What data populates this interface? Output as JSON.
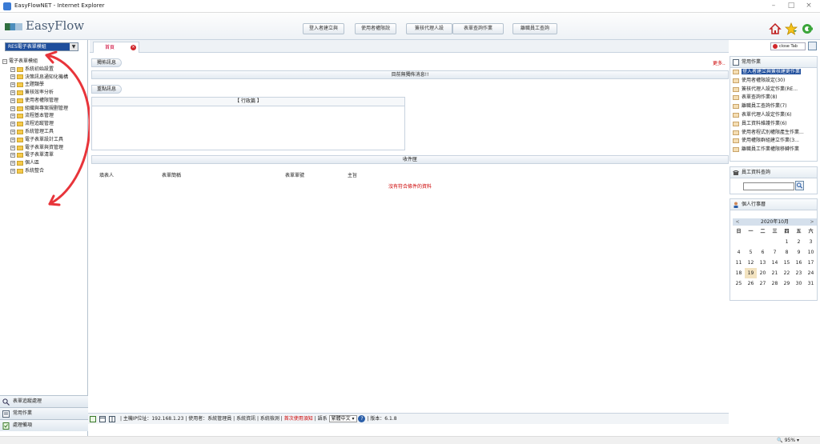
{
  "window": {
    "title": "EasyFlowNET - Internet Explorer"
  },
  "app": {
    "logo_text": "EasyFlow"
  },
  "header": {
    "buttons": [
      "登入者建立與",
      "使用者權限說",
      "簽核代理人設",
      "表單查詢作業",
      "離職員工查詢"
    ]
  },
  "left_panel": {
    "unit_select": "RES電子表單模組",
    "tree_root": "電子表單模組",
    "tree_items": [
      "系統初始設置",
      "決策訊息通知化機構",
      "主題類學",
      "簽核效率分析",
      "使用者權限管理",
      "組織與專案規劃管理",
      "流程基本管理",
      "流程追蹤管理",
      "系統管理工具",
      "電子表單設計工具",
      "電子表單與資管理",
      "電子表單清單",
      "個人區",
      "系統整合"
    ],
    "bottom_items": [
      "表單追蹤處理",
      "常用作業",
      "處理備項"
    ]
  },
  "annotation": {
    "glyph": "?"
  },
  "tabs": {
    "home": "首頁",
    "close_tab": "close Tab"
  },
  "main": {
    "news_label": "獨佈訊息",
    "more_link": "更多..",
    "news_empty": "目前無獨佈消息!!",
    "board_label": "重點訊息",
    "board_title": "【 行政篇 】",
    "inbox_title": "收件匣",
    "inbox_columns": [
      "填表人",
      "表單簡稱",
      "表單單號",
      "主旨"
    ],
    "inbox_empty": "沒有符合條件的資料"
  },
  "status_bar": {
    "text_left": "| 主機IP位址：192.168.1.23 | 使用者：系統管理員 | 系統資訊 | 系統檢測 |",
    "text_red": "首次使用須知",
    "text_lang_label": "| 語系",
    "lang_value": "繁體中文",
    "text_version": "| 版本：6.1.8"
  },
  "right_panel": {
    "favorites_title": "常用作業",
    "favorites": [
      "登入者建立與簽核建更作業",
      "使用者權限設定(30)",
      "簽核代理人設定作業(RE...",
      "表單查詢作業(8)",
      "離職員工查詢作業(7)",
      "表單代理人設定作業(6)",
      "員工資料維護作業(6)",
      "使用者程式別權限產生作業...",
      "使用權限群組建立作業(3...",
      "離職員工作業權限移轉作業"
    ],
    "employee_search_title": "員工資料查詢",
    "calendar_title": "個人行事曆",
    "calendar_month": "2020年10月",
    "calendar_prev": "<",
    "calendar_next": ">",
    "weekdays": [
      "日",
      "一",
      "二",
      "三",
      "四",
      "五",
      "六"
    ],
    "weeks": [
      [
        "",
        "",
        "",
        "",
        "1",
        "2",
        "3"
      ],
      [
        "4",
        "5",
        "6",
        "7",
        "8",
        "9",
        "10"
      ],
      [
        "11",
        "12",
        "13",
        "14",
        "15",
        "16",
        "17"
      ],
      [
        "18",
        "19",
        "20",
        "21",
        "22",
        "23",
        "24"
      ],
      [
        "25",
        "26",
        "27",
        "28",
        "29",
        "30",
        "31"
      ]
    ],
    "today": "19"
  },
  "ie_status": {
    "zoom": "95%"
  },
  "colors": {
    "accent": "#1e4e9c",
    "alert": "#cc0000",
    "annotation": "#e8343a"
  }
}
